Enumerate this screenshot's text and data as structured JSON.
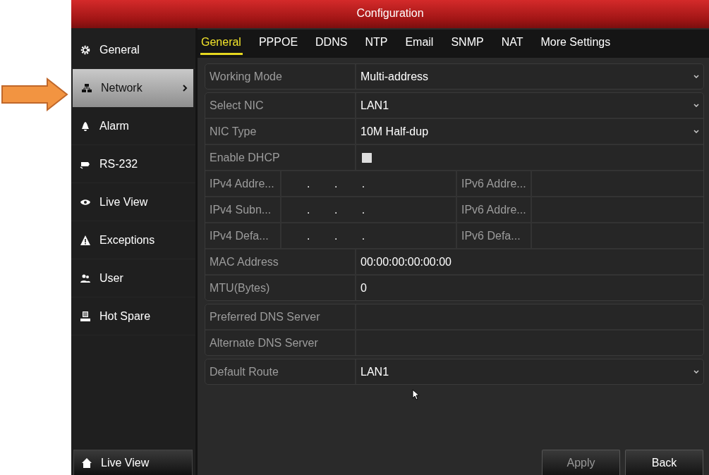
{
  "window": {
    "title": "Configuration"
  },
  "sidebar": {
    "items": [
      {
        "label": "General",
        "selected": false
      },
      {
        "label": "Network",
        "selected": true
      },
      {
        "label": "Alarm",
        "selected": false
      },
      {
        "label": "RS-232",
        "selected": false
      },
      {
        "label": "Live View",
        "selected": false
      },
      {
        "label": "Exceptions",
        "selected": false
      },
      {
        "label": "User",
        "selected": false
      },
      {
        "label": "Hot Spare",
        "selected": false
      }
    ],
    "bottom_button": {
      "label": "Live View"
    }
  },
  "tabs": [
    {
      "label": "General",
      "selected": true
    },
    {
      "label": "PPPOE",
      "selected": false
    },
    {
      "label": "DDNS",
      "selected": false
    },
    {
      "label": "NTP",
      "selected": false
    },
    {
      "label": "Email",
      "selected": false
    },
    {
      "label": "SNMP",
      "selected": false
    },
    {
      "label": "NAT",
      "selected": false
    },
    {
      "label": "More Settings",
      "selected": false
    }
  ],
  "form": {
    "groups": [
      {
        "rows": [
          {
            "kind": "select",
            "label": "Working Mode",
            "value": "Multi-address"
          }
        ]
      },
      {
        "rows": [
          {
            "kind": "select",
            "label": "Select NIC",
            "value": "LAN1"
          },
          {
            "kind": "select",
            "label": "NIC Type",
            "value": "10M Half-dup"
          },
          {
            "kind": "checkbox",
            "label": "Enable DHCP",
            "checked": false
          },
          {
            "kind": "dual",
            "label": "IPv4 Addre...",
            "value": ". . .",
            "label_2": "IPv6 Addre..."
          },
          {
            "kind": "dual",
            "label": "IPv4 Subn...",
            "value": ". . .",
            "label_2": "IPv6 Addre..."
          },
          {
            "kind": "dual",
            "label": "IPv4 Defa...",
            "value": ". . .",
            "label_2": "IPv6 Defa..."
          },
          {
            "kind": "text",
            "label": "MAC Address",
            "value": "00:00:00:00:00:00"
          },
          {
            "kind": "text",
            "label": "MTU(Bytes)",
            "value": "0"
          }
        ]
      },
      {
        "rows": [
          {
            "kind": "text",
            "label": "Preferred DNS Server"
          },
          {
            "kind": "text",
            "label": "Alternate DNS Server"
          }
        ]
      },
      {
        "rows": [
          {
            "kind": "select",
            "label": "Default Route",
            "value": "LAN1"
          }
        ]
      }
    ]
  },
  "buttons": [
    {
      "label": "Apply",
      "disabled": true
    },
    {
      "label": "Back",
      "disabled": false
    }
  ]
}
